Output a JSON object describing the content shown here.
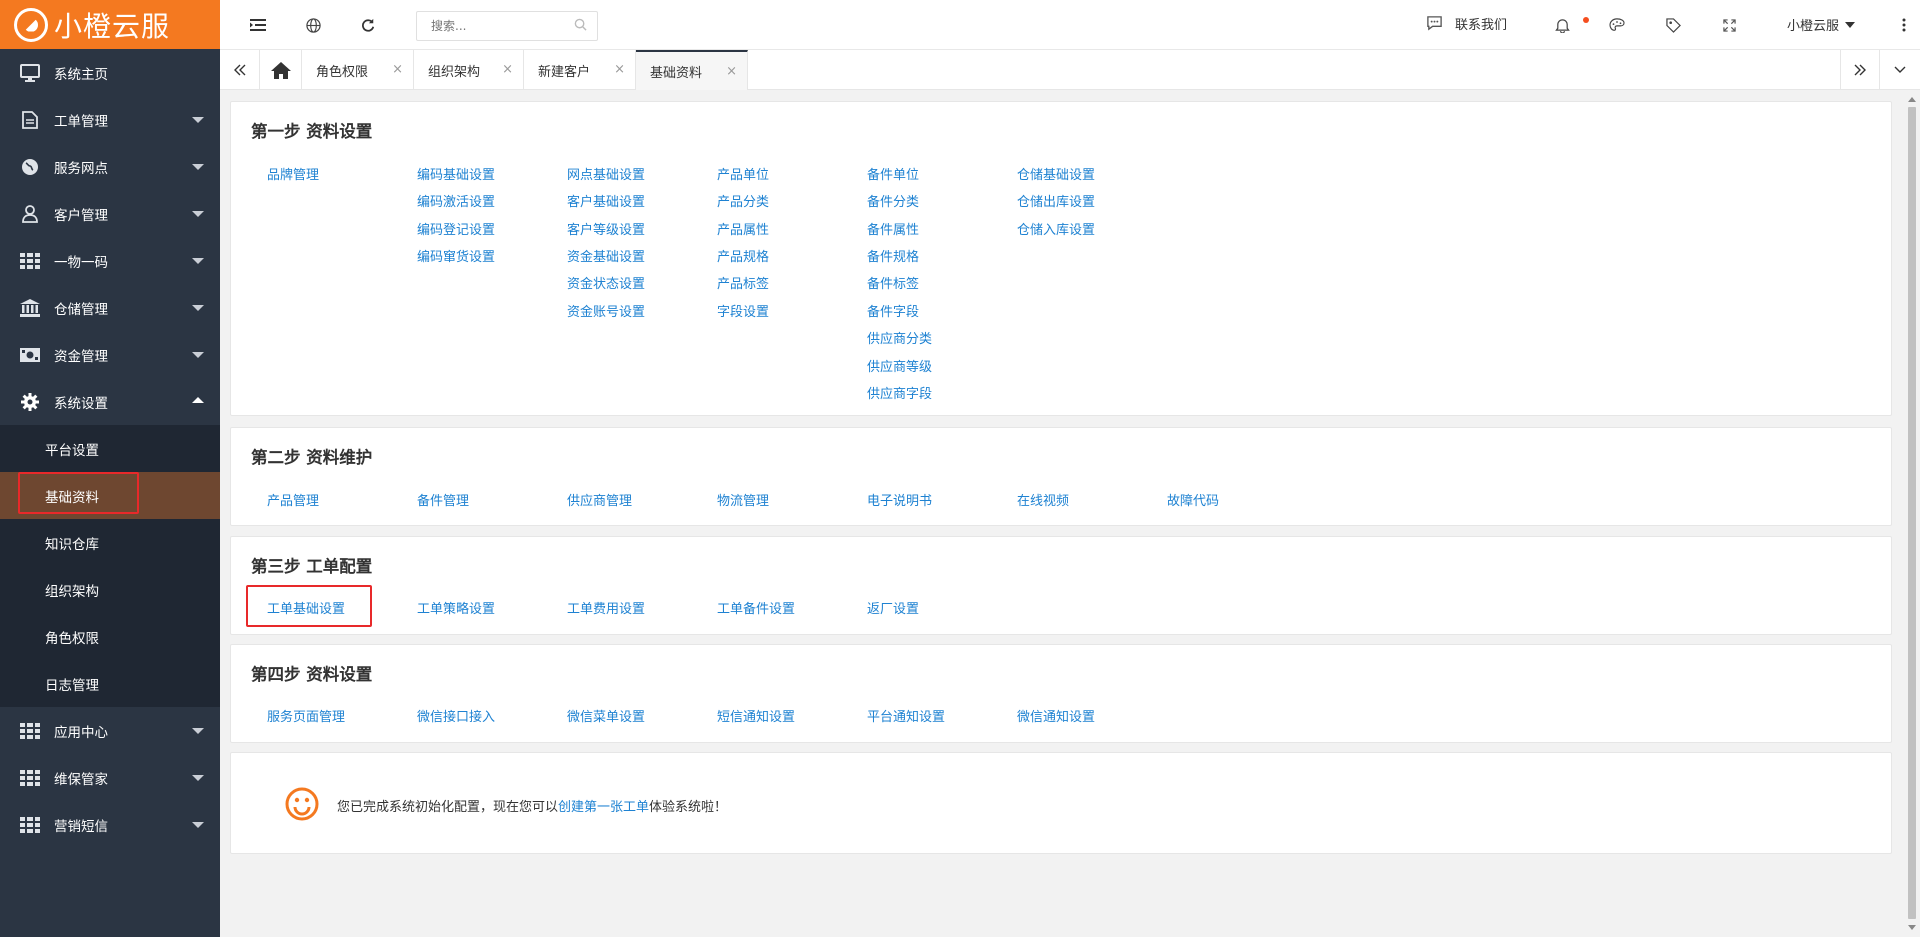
{
  "app": {
    "logo_text": "小橙云服",
    "brand_color": "#f47920",
    "sidebar_color": "#2b3543",
    "link_color": "#1e82d2",
    "highlight_color": "#e8292a"
  },
  "sidebar": {
    "items": [
      {
        "label": "系统主页",
        "icon": "monitor-icon"
      },
      {
        "label": "工单管理",
        "icon": "document-icon"
      },
      {
        "label": "服务网点",
        "icon": "globe-icon"
      },
      {
        "label": "客户管理",
        "icon": "user-icon"
      },
      {
        "label": "一物一码",
        "icon": "grid-icon"
      },
      {
        "label": "仓储管理",
        "icon": "bank-icon"
      },
      {
        "label": "资金管理",
        "icon": "money-icon"
      },
      {
        "label": "系统设置",
        "icon": "gear-icon"
      }
    ],
    "submenu": [
      "平台设置",
      "基础资料",
      "知识仓库",
      "组织架构",
      "角色权限",
      "日志管理"
    ],
    "after": [
      {
        "label": "应用中心",
        "icon": "grid-icon"
      },
      {
        "label": "维保管家",
        "icon": "grid-icon"
      },
      {
        "label": "营销短信",
        "icon": "grid-icon"
      }
    ]
  },
  "header": {
    "search_placeholder": "搜索...",
    "contact_label": "联系我们",
    "user_name": "小橙云服"
  },
  "tabs": [
    "角色权限",
    "组织架构",
    "新建客户",
    "基础资料"
  ],
  "steps": [
    {
      "title": "第一步 资料设置",
      "columns": [
        [
          "品牌管理"
        ],
        [
          "编码基础设置",
          "编码激活设置",
          "编码登记设置",
          "编码窜货设置"
        ],
        [
          "网点基础设置",
          "客户基础设置",
          "客户等级设置",
          "资金基础设置",
          "资金状态设置",
          "资金账号设置"
        ],
        [
          "产品单位",
          "产品分类",
          "产品属性",
          "产品规格",
          "产品标签",
          "字段设置"
        ],
        [
          "备件单位",
          "备件分类",
          "备件属性",
          "备件规格",
          "备件标签",
          "备件字段",
          "供应商分类",
          "供应商等级",
          "供应商字段"
        ],
        [
          "仓储基础设置",
          "仓储出库设置",
          "仓储入库设置"
        ]
      ]
    },
    {
      "title": "第二步 资料维护",
      "links": [
        "产品管理",
        "备件管理",
        "供应商管理",
        "物流管理",
        "电子说明书",
        "在线视频",
        "故障代码"
      ]
    },
    {
      "title": "第三步 工单配置",
      "links": [
        "工单基础设置",
        "工单策略设置",
        "工单费用设置",
        "工单备件设置",
        "返厂设置"
      ]
    },
    {
      "title": "第四步 资料设置",
      "links": [
        "服务页面管理",
        "微信接口接入",
        "微信菜单设置",
        "短信通知设置",
        "平台通知设置",
        "微信通知设置"
      ]
    }
  ],
  "completion": {
    "text_before": "您已完成系统初始化配置，现在您可以",
    "link": "创建第一张工单",
    "text_after": "体验系统啦！"
  }
}
